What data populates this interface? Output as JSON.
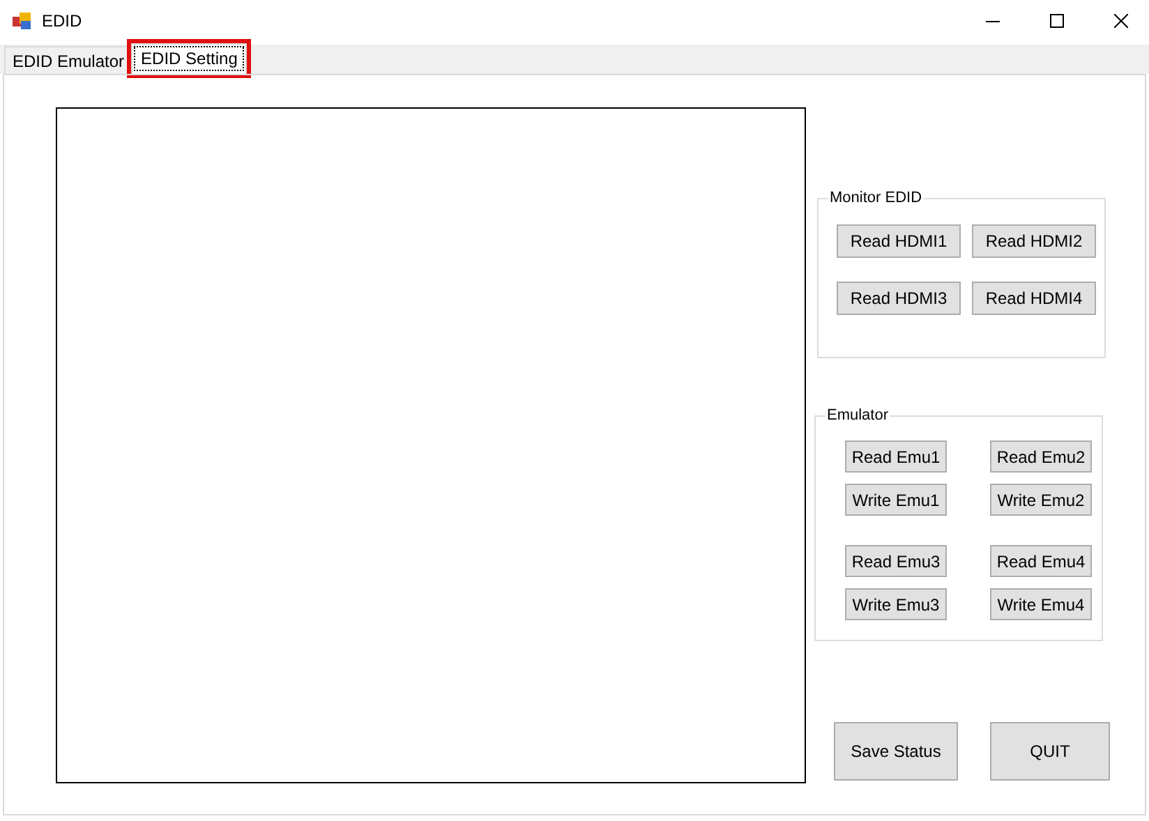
{
  "window": {
    "title": "EDID"
  },
  "tabs": [
    {
      "label": "EDID Emulator",
      "selected": false,
      "highlighted": false
    },
    {
      "label": "EDID Setting",
      "selected": true,
      "highlighted": true
    }
  ],
  "monitor_edid": {
    "title": "Monitor EDID",
    "buttons": [
      "Read HDMI1",
      "Read HDMI2",
      "Read HDMI3",
      "Read HDMI4"
    ]
  },
  "emulator": {
    "title": "Emulator",
    "buttons": [
      "Read Emu1",
      "Read Emu2",
      "Write Emu1",
      "Write Emu2",
      "Read Emu3",
      "Read Emu4",
      "Write Emu3",
      "Write Emu4"
    ]
  },
  "actions": [
    "Save Status",
    "QUIT"
  ]
}
